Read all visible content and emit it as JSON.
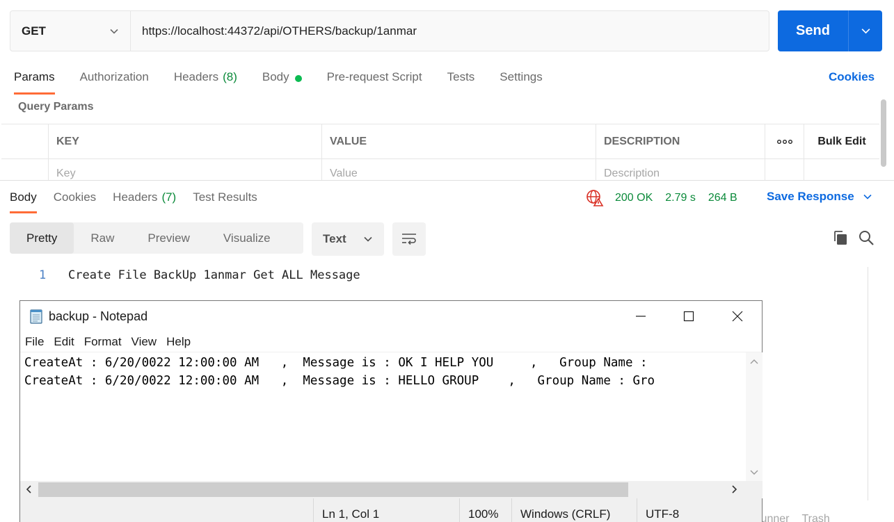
{
  "request": {
    "method": "GET",
    "url": "https://localhost:44372/api/OTHERS/backup/1anmar",
    "send_label": "Send"
  },
  "request_tabs": [
    {
      "label": "Params",
      "count": ""
    },
    {
      "label": "Authorization",
      "count": ""
    },
    {
      "label": "Headers",
      "count": "(8)"
    },
    {
      "label": "Body",
      "count": ""
    },
    {
      "label": "Pre-request Script",
      "count": ""
    },
    {
      "label": "Tests",
      "count": ""
    },
    {
      "label": "Settings",
      "count": ""
    }
  ],
  "cookies_link": "Cookies",
  "query_params": {
    "title": "Query Params",
    "headers": [
      "KEY",
      "VALUE",
      "DESCRIPTION",
      "Bulk Edit"
    ],
    "placeholders": [
      "Key",
      "Value",
      "Description"
    ]
  },
  "response_tabs": [
    {
      "label": "Body",
      "count": ""
    },
    {
      "label": "Cookies",
      "count": ""
    },
    {
      "label": "Headers",
      "count": "(7)"
    },
    {
      "label": "Test Results",
      "count": ""
    }
  ],
  "response_status": {
    "code": "200 OK",
    "time": "2.79 s",
    "size": "264 B",
    "save_label": "Save Response"
  },
  "view_modes": [
    "Pretty",
    "Raw",
    "Preview",
    "Visualize"
  ],
  "format_select": "Text",
  "response_body": {
    "line_number": "1",
    "text": "Create File BackUp 1anmar Get ALL Message"
  },
  "bottom_bar": [
    "Runner",
    "Trash"
  ],
  "notepad": {
    "title": "backup - Notepad",
    "menu": [
      "File",
      "Edit",
      "Format",
      "View",
      "Help"
    ],
    "lines": [
      "CreateAt : 6/20/0022 12:00:00 AM   ,  Message is : OK I HELP YOU     ,   Group Name : ",
      "CreateAt : 6/20/0022 12:00:00 AM   ,  Message is : HELLO GROUP    ,   Group Name : Gro"
    ],
    "status": {
      "position": "Ln 1, Col 1",
      "zoom": "100%",
      "line_endings": "Windows (CRLF)",
      "encoding": "UTF-8"
    }
  },
  "colors": {
    "accent": "#0d6ae0",
    "active_tab_underline": "#ff6c37",
    "status_green": "#0b8a3a",
    "body_dot": "#0cbb52"
  }
}
